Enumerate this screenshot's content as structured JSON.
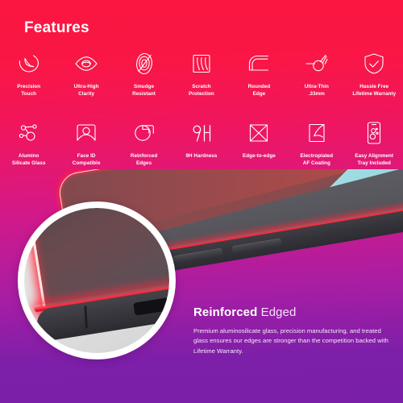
{
  "heading": "Features",
  "colors": {
    "bg_top": "#FB1540",
    "bg_mid": "#C2188C",
    "bg_bottom": "#7A1FA8",
    "icon_stroke": "#FFFFFF",
    "edge_glow": "#FF2B3F",
    "wallpaper_cyan": "#9BDCE3",
    "magnifier_ring": "#FFFFFF"
  },
  "features_row1": [
    {
      "icon": "precision-touch-icon",
      "label": "Precision\nTouch"
    },
    {
      "icon": "eye-clarity-icon",
      "label": "Ultra-High\nClarity"
    },
    {
      "icon": "fingerprint-smudge-icon",
      "label": "Smudge\nResistant"
    },
    {
      "icon": "scratch-protection-icon",
      "label": "Scratch\nProtection"
    },
    {
      "icon": "rounded-edge-icon",
      "label": "Rounded\nEdge"
    },
    {
      "icon": "caliper-thin-icon",
      "label": "Ultra-Thin\n.33mm"
    },
    {
      "icon": "shield-check-icon",
      "label": "Hassle Free\nLifetime Warranty"
    }
  ],
  "features_row2": [
    {
      "icon": "molecule-icon",
      "label": "Alumino\nSilicate Glass"
    },
    {
      "icon": "face-id-icon",
      "label": "Face ID\nCompatible"
    },
    {
      "icon": "reinforced-edges-icon",
      "label": "Reinforced\nEdges"
    },
    {
      "icon": "nine-h-hardness-icon",
      "label": "9H Hardness"
    },
    {
      "icon": "edge-to-edge-icon",
      "label": "Edge-to-edge"
    },
    {
      "icon": "electroplated-coating-icon",
      "label": "Electroplated\nAF Coating"
    },
    {
      "icon": "alignment-tray-icon",
      "label": "Easy Alignment\nTray Included"
    }
  ],
  "caption": {
    "title_strong": "Reinforced",
    "title_light": " Edged",
    "body": "Premium aluminosilicate glass, precision manufacturing, and treated glass ensures our edges are stronger than the competition backed with Lifetime Warranty."
  }
}
